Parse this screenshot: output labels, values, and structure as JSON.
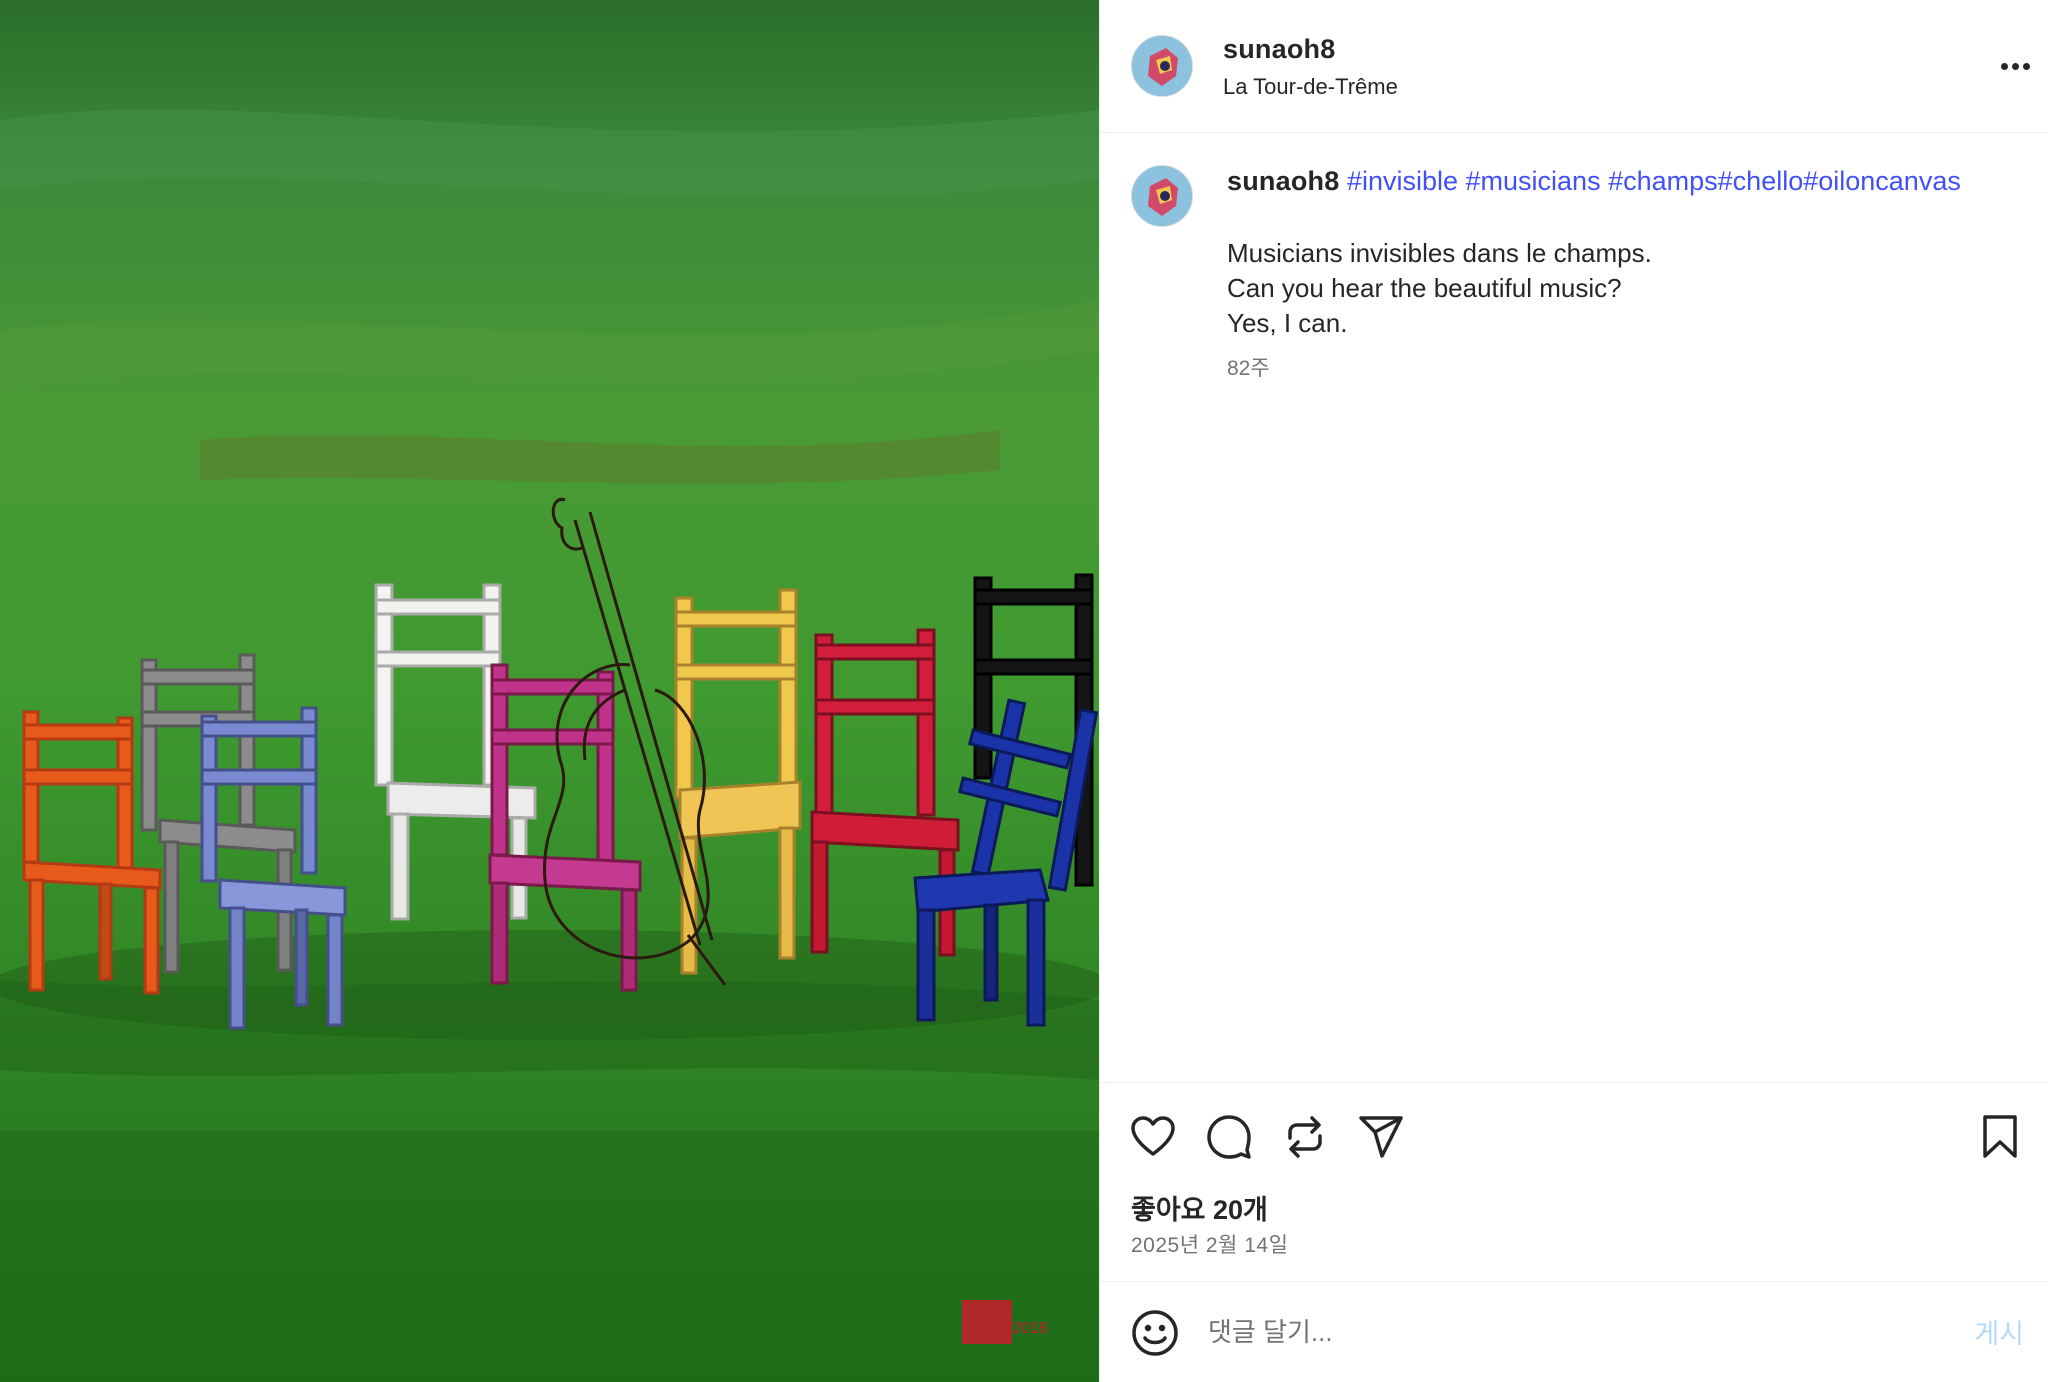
{
  "post": {
    "image_alt": "Painting of colorful chairs and a cello on green grass",
    "signature_mark": "2018"
  },
  "header": {
    "username": "sunaoh8",
    "location": "La Tour-de-Trême",
    "more_icon": "more-horizontal-icon"
  },
  "caption": {
    "username": "sunaoh8",
    "hashtags": [
      "#invisible",
      "#musicians",
      "#champs",
      "#chello",
      "#oiloncanvas"
    ],
    "lines": [
      "Musicians invisibles dans le champs.",
      "Can you hear the beautiful music?",
      "Yes, I can."
    ],
    "age": "82주"
  },
  "actions": {
    "icons": [
      "heart-icon",
      "comment-icon",
      "repost-icon",
      "share-icon",
      "bookmark-icon"
    ],
    "likes": "좋아요 20개",
    "date": "2025년 2월 14일"
  },
  "comment": {
    "placeholder": "댓글 달기...",
    "post_label": "게시",
    "emoji_icon": "emoji-icon"
  },
  "colors": {
    "hashtag": "#4150f7",
    "post_button_disabled": "#b3d9fb",
    "muted_text": "#737373",
    "grass": "#2f7d1f"
  }
}
